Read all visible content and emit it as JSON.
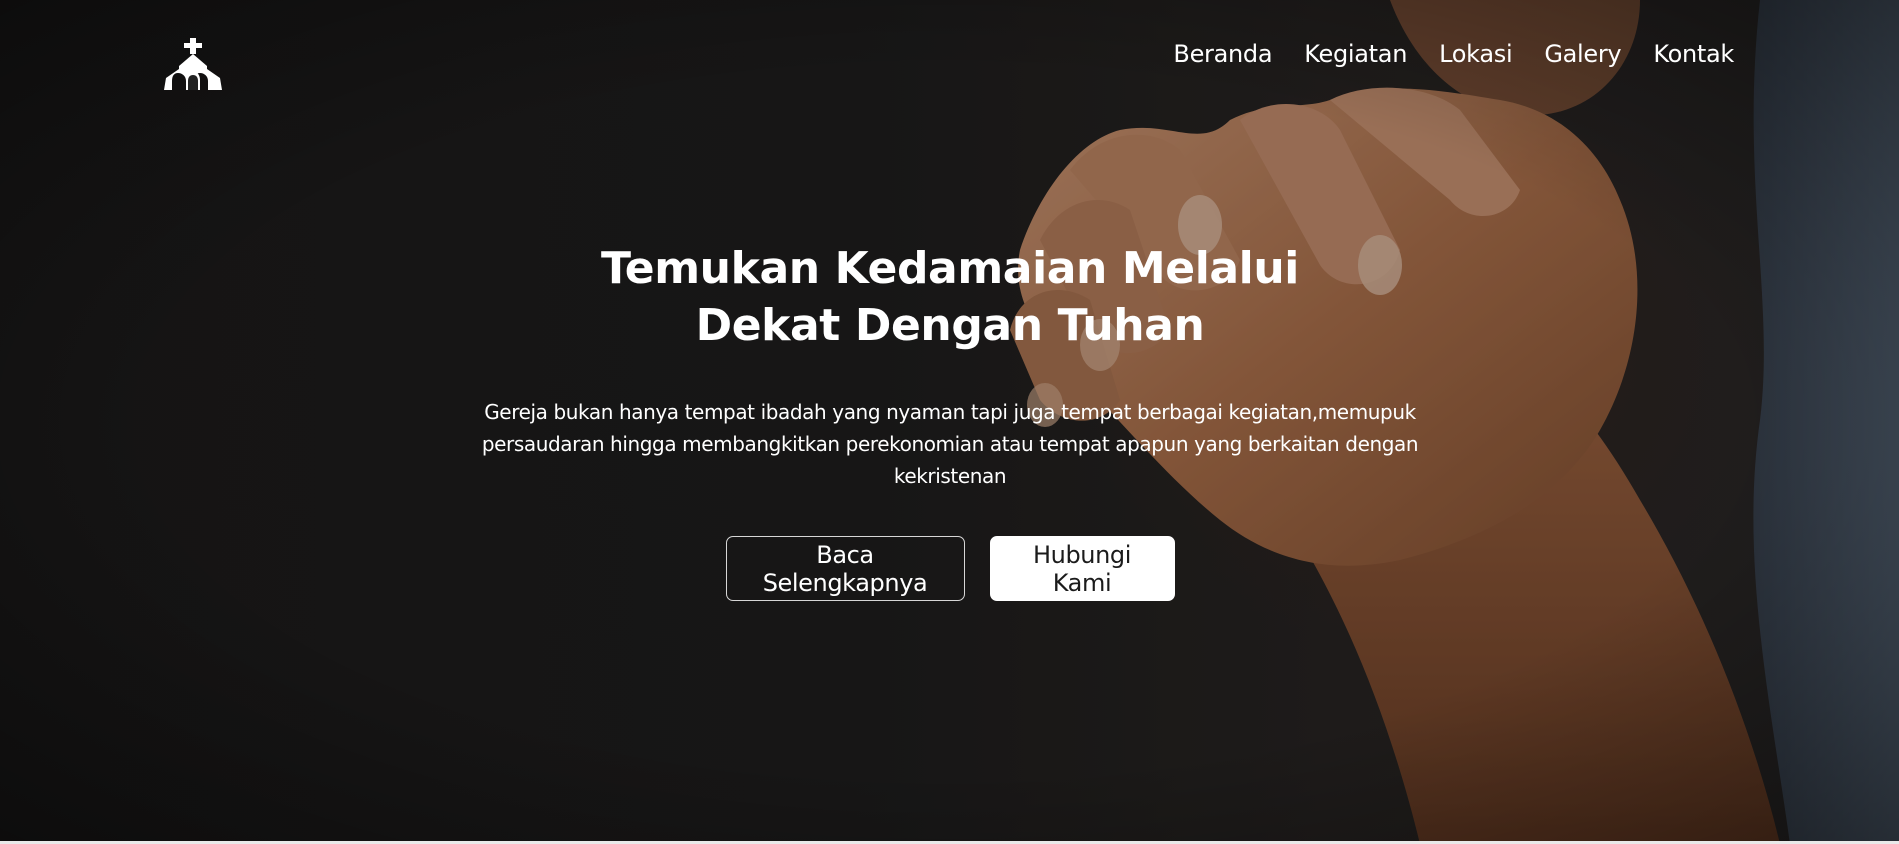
{
  "nav": {
    "items": [
      {
        "label": "Beranda"
      },
      {
        "label": "Kegiatan"
      },
      {
        "label": "Lokasi"
      },
      {
        "label": "Galery"
      },
      {
        "label": "Kontak"
      }
    ]
  },
  "hero": {
    "title": "Temukan Kedamaian Melalui Dekat Dengan Tuhan",
    "description": "Gereja bukan hanya tempat ibadah yang nyaman tapi juga tempat berbagai kegiatan,memupuk persaudaran hingga membangkitkan perekonomian atau tempat apapun yang berkaitan dengan kekristenan",
    "primary_button": "Baca Selengkapnya",
    "secondary_button": "Hubungi Kami"
  },
  "colors": {
    "background": "#1e1d1d",
    "text": "#ffffff",
    "button_solid_bg": "#ffffff",
    "button_solid_text": "#1b1b1b"
  },
  "icons": {
    "logo": "church-icon"
  }
}
